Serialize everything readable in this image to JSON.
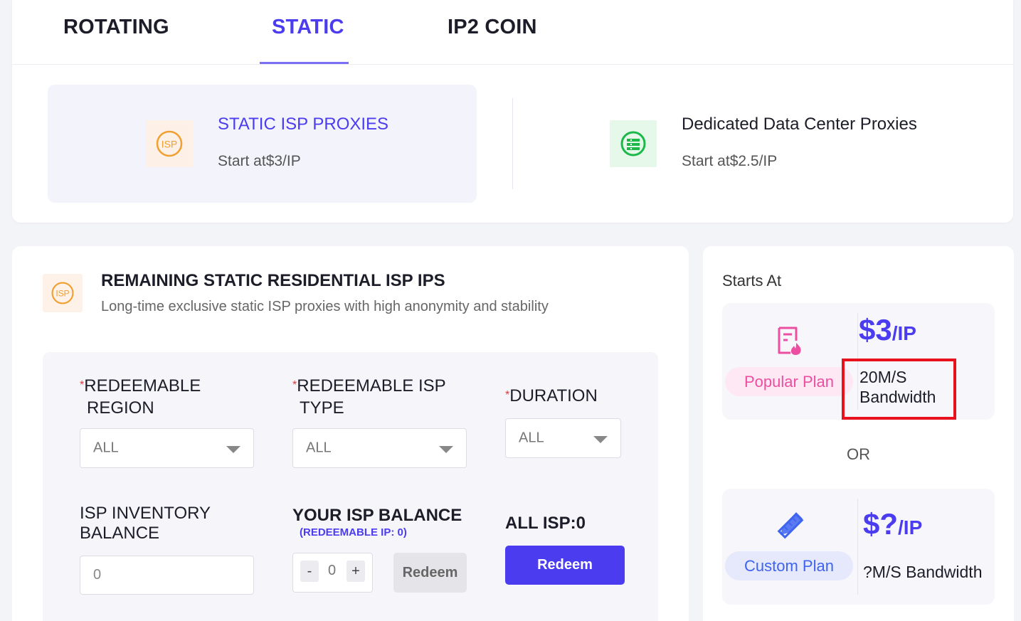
{
  "tabs": [
    {
      "label": "ROTATING",
      "active": false
    },
    {
      "label": "STATIC",
      "active": true
    },
    {
      "label": "IP2 COIN",
      "active": false
    }
  ],
  "products": [
    {
      "title": "STATIC ISP PROXIES",
      "subtitle": "Start at$3/IP",
      "icon": "isp-icon",
      "active": true
    },
    {
      "title": "Dedicated Data Center Proxies",
      "subtitle": "Start at$2.5/IP",
      "icon": "server-icon",
      "active": false
    }
  ],
  "section": {
    "title": "REMAINING STATIC RESIDENTIAL ISP IPS",
    "description": "Long-time exclusive static ISP proxies with high anonymity and stability",
    "icon": "isp-icon"
  },
  "form": {
    "region": {
      "label_line1": "REDEEMABLE",
      "label_line2": "REGION",
      "required": "*",
      "value": "ALL"
    },
    "isp_type": {
      "label_line1": "REDEEMABLE ISP",
      "label_line2": "TYPE",
      "required": "*",
      "value": "ALL"
    },
    "duration": {
      "label": "DURATION",
      "required": "*",
      "value": "ALL"
    },
    "inventory": {
      "label_line1": "ISP INVENTORY",
      "label_line2": "BALANCE",
      "value": "0"
    },
    "balance": {
      "label": "YOUR ISP BALANCE",
      "sublabel": "(REDEEMABLE IP: 0)",
      "minus": "-",
      "plus": "+",
      "value": "0",
      "redeem_label": "Redeem"
    },
    "all_isp": {
      "label": "ALL ISP:0",
      "redeem_label": "Redeem"
    }
  },
  "pricing": {
    "starts_at": "Starts At",
    "or": "OR",
    "popular": {
      "pill": "Popular Plan",
      "price": "$3",
      "unit": "/IP",
      "bw_line1": "20M/S",
      "bw_line2": "Bandwidth",
      "icon": "document-fire-icon"
    },
    "custom": {
      "pill": "Custom Plan",
      "price": "$?",
      "unit": "/IP",
      "bw": "?M/S Bandwidth",
      "icon": "pencil-ruler-icon"
    }
  },
  "colors": {
    "accent": "#4b3cf0",
    "highlight": "#e8121e",
    "popular_pill": "#fde8f3",
    "custom_pill": "#e6e8fb",
    "isp_icon": "#f0a030",
    "server_icon": "#1cb84a"
  }
}
